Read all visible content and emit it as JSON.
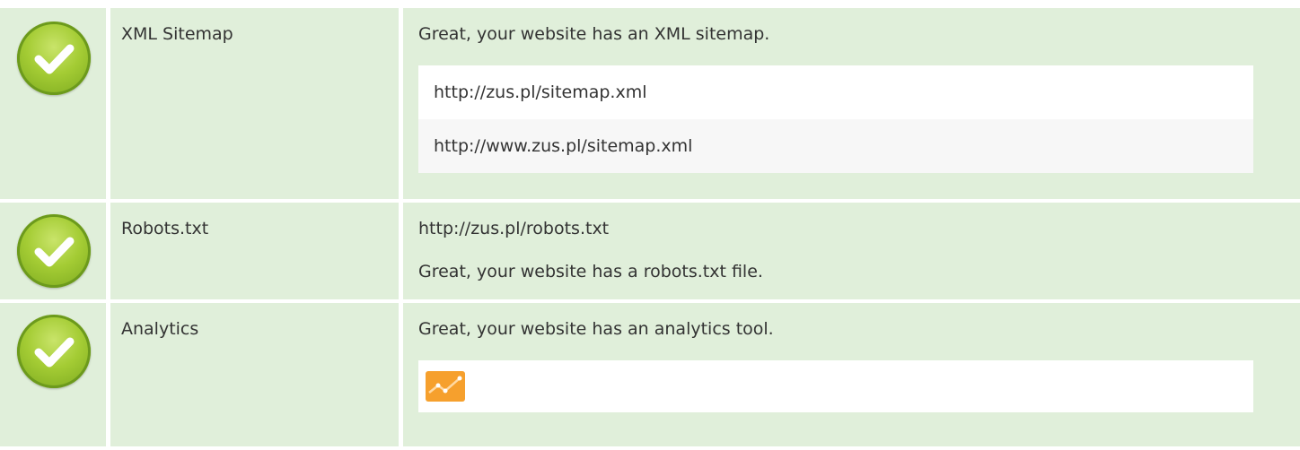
{
  "rows": [
    {
      "label": "XML Sitemap",
      "status_icon": "check-circle-icon",
      "description": "Great, your website has an XML sitemap.",
      "links": [
        "http://zus.pl/sitemap.xml",
        "http://www.zus.pl/sitemap.xml"
      ]
    },
    {
      "label": "Robots.txt",
      "status_icon": "check-circle-icon",
      "url": "http://zus.pl/robots.txt",
      "description": "Great, your website has a robots.txt file."
    },
    {
      "label": "Analytics",
      "status_icon": "check-circle-icon",
      "description": "Great, your website has an analytics tool.",
      "tool_icon": "google-analytics-icon"
    }
  ],
  "colors": {
    "row_background": "#e0efda",
    "check_green": "#8dbf2a",
    "tool_orange": "#f6a02d"
  }
}
